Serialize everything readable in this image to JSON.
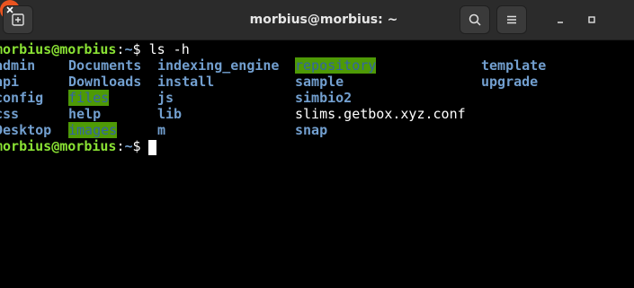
{
  "window": {
    "title": "morbius@morbius: ~"
  },
  "icons": {
    "new_tab": "new-tab-icon",
    "search": "search-icon",
    "menu": "hamburger-menu-icon",
    "minimize": "minimize-icon",
    "maximize": "maximize-icon",
    "close": "close-icon"
  },
  "colors": {
    "background": "#000000",
    "prompt_user": "#8ae234",
    "prompt_path": "#729fcf",
    "directory": "#729fcf",
    "highlight_bg": "#4e9a06",
    "highlight_fg": "#3465a4",
    "close_button": "#e95420"
  },
  "terminal": {
    "prompt": {
      "user_host": "morbius@morbius",
      "separator": ":",
      "path": "~",
      "symbol": "$ "
    },
    "command": "ls -h",
    "listing": {
      "col1": [
        "admin",
        "api",
        "config",
        "css",
        "Desktop"
      ],
      "col2": [
        "Documents",
        "Downloads",
        "files",
        "help",
        "images"
      ],
      "col3": [
        "indexing_engine",
        "install",
        "js",
        "lib",
        "m"
      ],
      "col4": [
        "repository",
        "sample",
        "simbio2",
        "slims.getbox.xyz.conf",
        "snap"
      ],
      "col5": [
        "template",
        "upgrade"
      ]
    }
  }
}
